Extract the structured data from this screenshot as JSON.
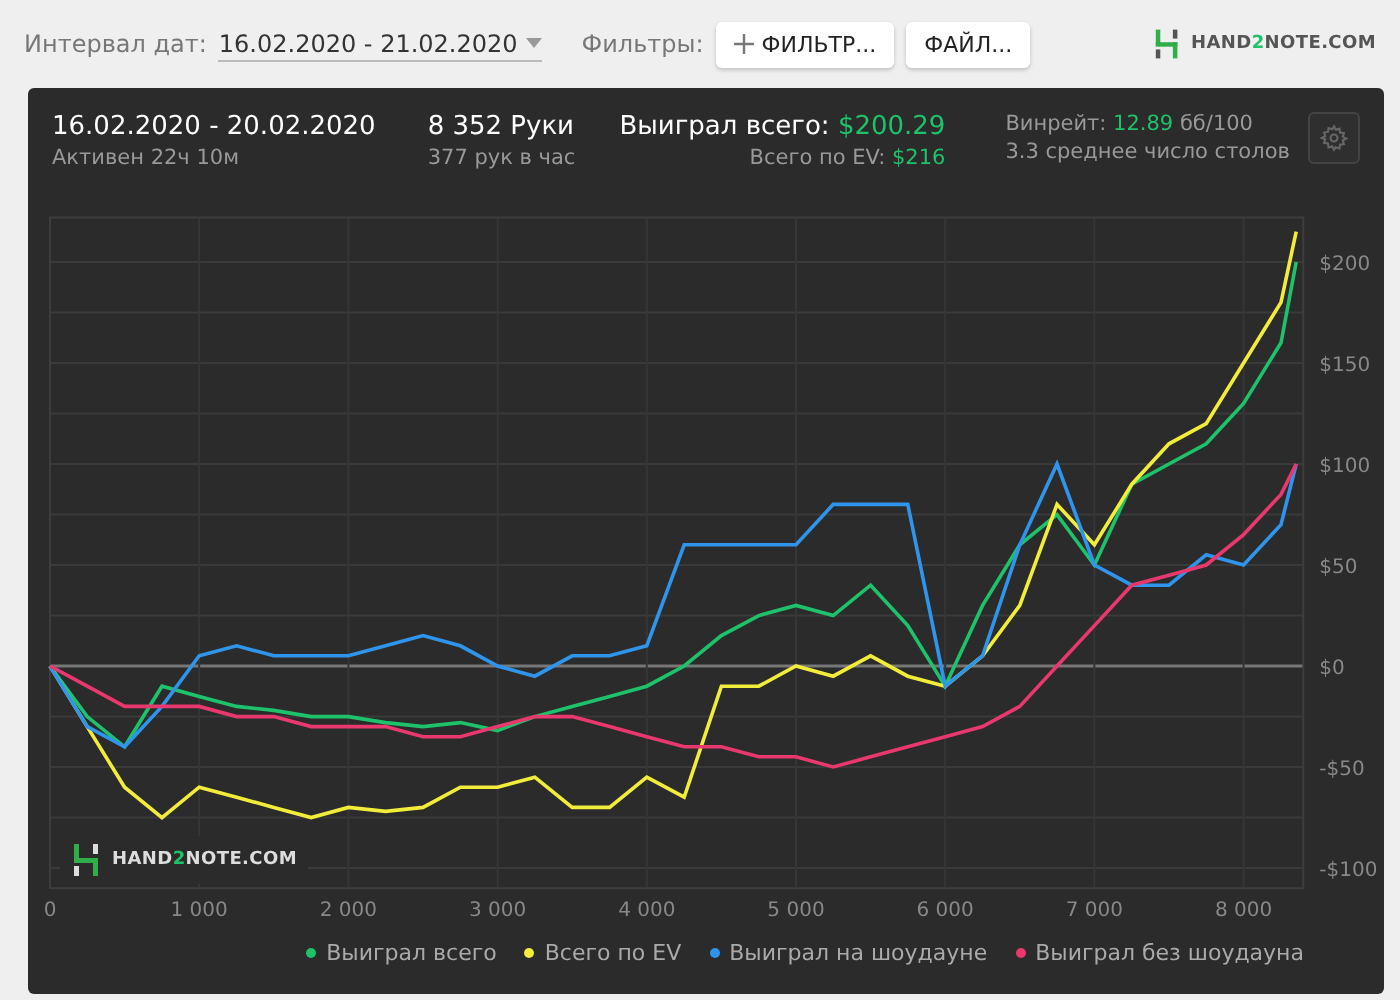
{
  "toolbar": {
    "date_label": "Интервал дат:",
    "date_value": "16.02.2020 - 21.02.2020",
    "filters_label": "Фильтры:",
    "filter_button": "ФИЛЬТР...",
    "file_button": "ФАЙЛ..."
  },
  "brand": {
    "before": "HAND",
    "accent": "2",
    "after": "NOTE.COM"
  },
  "summary": {
    "period": "16.02.2020 - 20.02.2020",
    "active": "Активен 22ч 10м",
    "hands": "8 352 Руки",
    "hands_per_hour": "377 рук в час",
    "won_label": "Выиграл всего:",
    "won_value": "$200.29",
    "ev_label": "Всего по EV:",
    "ev_value": "$216",
    "winrate_label": "Винрейт:",
    "winrate_value": "12.89",
    "winrate_unit": "бб/100",
    "tables": "3.3 среднее число столов"
  },
  "chart_watermark": {
    "before": "HAND",
    "accent": "2",
    "after": "NOTE.COM"
  },
  "chart_data": {
    "type": "line",
    "grid": true,
    "x": [
      0,
      250,
      500,
      750,
      1000,
      1250,
      1500,
      1750,
      2000,
      2250,
      2500,
      2750,
      3000,
      3250,
      3500,
      3750,
      4000,
      4250,
      4500,
      4750,
      5000,
      5250,
      5500,
      5750,
      6000,
      6250,
      6500,
      6750,
      7000,
      7250,
      7500,
      7750,
      8000,
      8250,
      8352
    ],
    "xlim": [
      0,
      8400
    ],
    "ylim": [
      -110,
      222
    ],
    "xticks": [
      {
        "value": 0,
        "label": "0"
      },
      {
        "value": 1000,
        "label": "1 000"
      },
      {
        "value": 2000,
        "label": "2 000"
      },
      {
        "value": 3000,
        "label": "3 000"
      },
      {
        "value": 4000,
        "label": "4 000"
      },
      {
        "value": 5000,
        "label": "5 000"
      },
      {
        "value": 6000,
        "label": "6 000"
      },
      {
        "value": 7000,
        "label": "7 000"
      },
      {
        "value": 8000,
        "label": "8 000"
      }
    ],
    "yticks": [
      {
        "value": -100,
        "label": "-$100"
      },
      {
        "value": -50,
        "label": "-$50"
      },
      {
        "value": 0,
        "label": "$0"
      },
      {
        "value": 50,
        "label": "$50"
      },
      {
        "value": 100,
        "label": "$100"
      },
      {
        "value": 150,
        "label": "$150"
      },
      {
        "value": 200,
        "label": "$200"
      }
    ],
    "series": [
      {
        "name": "Выиграл всего",
        "color": "#1ec26a",
        "values": [
          0,
          -25,
          -40,
          -10,
          -15,
          -20,
          -22,
          -25,
          -25,
          -28,
          -30,
          -28,
          -32,
          -25,
          -20,
          -15,
          -10,
          0,
          15,
          25,
          30,
          25,
          40,
          20,
          -10,
          30,
          60,
          75,
          50,
          90,
          100,
          110,
          130,
          160,
          200
        ]
      },
      {
        "name": "Всего по EV",
        "color": "#f2ec3a",
        "values": [
          0,
          -30,
          -60,
          -75,
          -60,
          -65,
          -70,
          -75,
          -70,
          -72,
          -70,
          -60,
          -60,
          -55,
          -70,
          -70,
          -55,
          -65,
          -10,
          -10,
          0,
          -5,
          5,
          -5,
          -10,
          5,
          30,
          80,
          60,
          90,
          110,
          120,
          150,
          180,
          215
        ]
      },
      {
        "name": "Выиграл на шоудауне",
        "color": "#2f95ec",
        "values": [
          0,
          -30,
          -40,
          -20,
          5,
          10,
          5,
          5,
          5,
          10,
          15,
          10,
          0,
          -5,
          5,
          5,
          10,
          60,
          60,
          60,
          60,
          80,
          80,
          80,
          -10,
          5,
          60,
          100,
          50,
          40,
          40,
          55,
          50,
          70,
          100
        ]
      },
      {
        "name": "Выиграл без шоудауна",
        "color": "#e8386e",
        "values": [
          0,
          -10,
          -20,
          -20,
          -20,
          -25,
          -25,
          -30,
          -30,
          -30,
          -35,
          -35,
          -30,
          -25,
          -25,
          -30,
          -35,
          -40,
          -40,
          -45,
          -45,
          -50,
          -45,
          -40,
          -35,
          -30,
          -20,
          0,
          20,
          40,
          45,
          50,
          65,
          85,
          100
        ]
      }
    ]
  }
}
